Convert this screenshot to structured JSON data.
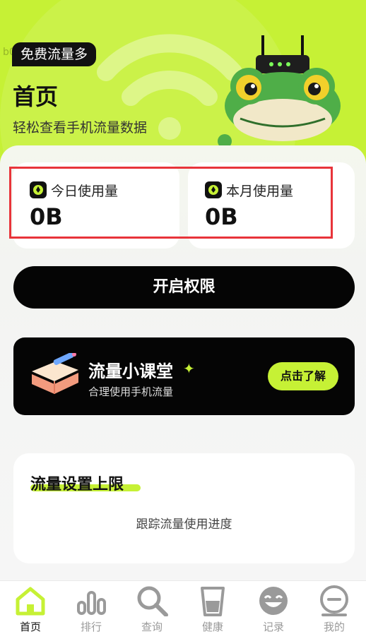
{
  "hero": {
    "badge": "免费流量多",
    "ghost": "b0",
    "title": "首页",
    "subtitle": "轻松查看手机流量数据"
  },
  "stats": [
    {
      "label": "今日使用量",
      "value": "0B"
    },
    {
      "label": "本月使用量",
      "value": "0B"
    }
  ],
  "primary_button": "开启权限",
  "course": {
    "title": "流量小课堂",
    "subtitle": "合理使用手机流量",
    "button": "点击了解"
  },
  "limit": {
    "title": "流量设置上限",
    "desc": "跟踪流量使用进度"
  },
  "tabs": [
    {
      "label": "首页",
      "icon": "home-icon"
    },
    {
      "label": "排行",
      "icon": "chart-icon"
    },
    {
      "label": "查询",
      "icon": "search-icon"
    },
    {
      "label": "健康",
      "icon": "cup-icon"
    },
    {
      "label": "记录",
      "icon": "smile-icon"
    },
    {
      "label": "我的",
      "icon": "profile-icon"
    }
  ],
  "colors": {
    "accent": "#c6f135",
    "dark": "#050505",
    "highlight": "#e8343a"
  }
}
